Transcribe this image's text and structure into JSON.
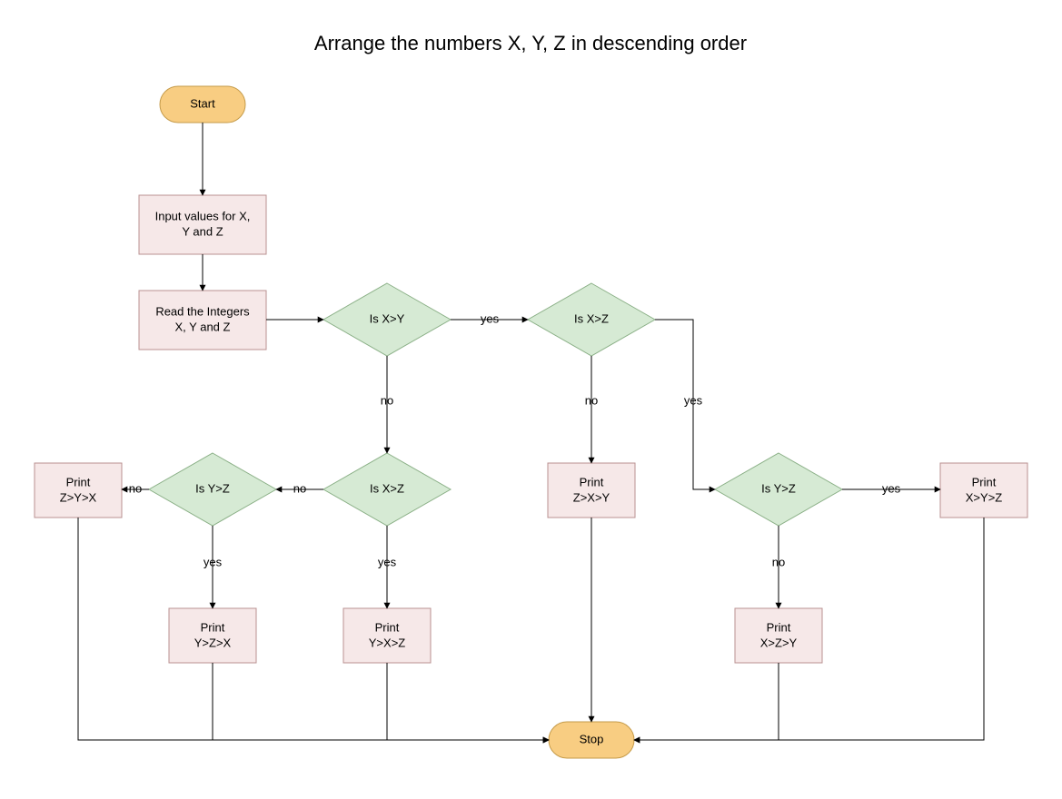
{
  "title": "Arrange the numbers X, Y, Z in descending order",
  "nodes": {
    "start": "Start",
    "stop": "Stop",
    "input_line1": "Input values for X,",
    "input_line2": "Y and Z",
    "read_line1": "Read the Integers",
    "read_line2": "X, Y and Z",
    "dec_xy": "Is X>Y",
    "dec_xz_right": "Is X>Z",
    "dec_xz_left": "Is X>Z",
    "dec_yz_left": "Is Y>Z",
    "dec_yz_right": "Is Y>Z",
    "print_zyx_l1": "Print",
    "print_zyx_l2": "Z>Y>X",
    "print_yzx_l1": "Print",
    "print_yzx_l2": "Y>Z>X",
    "print_yxz_l1": "Print",
    "print_yxz_l2": "Y>X>Z",
    "print_zxy_l1": "Print",
    "print_zxy_l2": "Z>X>Y",
    "print_xzy_l1": "Print",
    "print_xzy_l2": "X>Z>Y",
    "print_xyz_l1": "Print",
    "print_xyz_l2": "X>Y>Z"
  },
  "labels": {
    "yes": "yes",
    "no": "no"
  },
  "chart_data": {
    "type": "flowchart",
    "title": "Arrange the numbers X, Y, Z in descending order",
    "nodes": [
      {
        "id": "start",
        "type": "terminator",
        "label": "Start"
      },
      {
        "id": "input",
        "type": "process",
        "label": "Input values for X, Y and Z"
      },
      {
        "id": "read",
        "type": "process",
        "label": "Read the Integers X, Y and Z"
      },
      {
        "id": "dec_xy",
        "type": "decision",
        "label": "Is X>Y"
      },
      {
        "id": "dec_xz_r",
        "type": "decision",
        "label": "Is X>Z"
      },
      {
        "id": "dec_xz_l",
        "type": "decision",
        "label": "Is X>Z"
      },
      {
        "id": "dec_yz_l",
        "type": "decision",
        "label": "Is Y>Z"
      },
      {
        "id": "dec_yz_r",
        "type": "decision",
        "label": "Is Y>Z"
      },
      {
        "id": "print_zyx",
        "type": "process",
        "label": "Print Z>Y>X"
      },
      {
        "id": "print_yzx",
        "type": "process",
        "label": "Print Y>Z>X"
      },
      {
        "id": "print_yxz",
        "type": "process",
        "label": "Print Y>X>Z"
      },
      {
        "id": "print_zxy",
        "type": "process",
        "label": "Print Z>X>Y"
      },
      {
        "id": "print_xzy",
        "type": "process",
        "label": "Print X>Z>Y"
      },
      {
        "id": "print_xyz",
        "type": "process",
        "label": "Print X>Y>Z"
      },
      {
        "id": "stop",
        "type": "terminator",
        "label": "Stop"
      }
    ],
    "edges": [
      {
        "from": "start",
        "to": "input",
        "label": ""
      },
      {
        "from": "input",
        "to": "read",
        "label": ""
      },
      {
        "from": "read",
        "to": "dec_xy",
        "label": ""
      },
      {
        "from": "dec_xy",
        "to": "dec_xz_r",
        "label": "yes"
      },
      {
        "from": "dec_xy",
        "to": "dec_xz_l",
        "label": "no"
      },
      {
        "from": "dec_xz_r",
        "to": "dec_yz_r",
        "label": "yes"
      },
      {
        "from": "dec_xz_r",
        "to": "print_zxy",
        "label": "no"
      },
      {
        "from": "dec_xz_l",
        "to": "print_yxz",
        "label": "yes"
      },
      {
        "from": "dec_xz_l",
        "to": "dec_yz_l",
        "label": "no"
      },
      {
        "from": "dec_yz_l",
        "to": "print_yzx",
        "label": "yes"
      },
      {
        "from": "dec_yz_l",
        "to": "print_zyx",
        "label": "no"
      },
      {
        "from": "dec_yz_r",
        "to": "print_xyz",
        "label": "yes"
      },
      {
        "from": "dec_yz_r",
        "to": "print_xzy",
        "label": "no"
      },
      {
        "from": "print_zyx",
        "to": "stop",
        "label": ""
      },
      {
        "from": "print_yzx",
        "to": "stop",
        "label": ""
      },
      {
        "from": "print_yxz",
        "to": "stop",
        "label": ""
      },
      {
        "from": "print_zxy",
        "to": "stop",
        "label": ""
      },
      {
        "from": "print_xzy",
        "to": "stop",
        "label": ""
      },
      {
        "from": "print_xyz",
        "to": "stop",
        "label": ""
      }
    ]
  }
}
